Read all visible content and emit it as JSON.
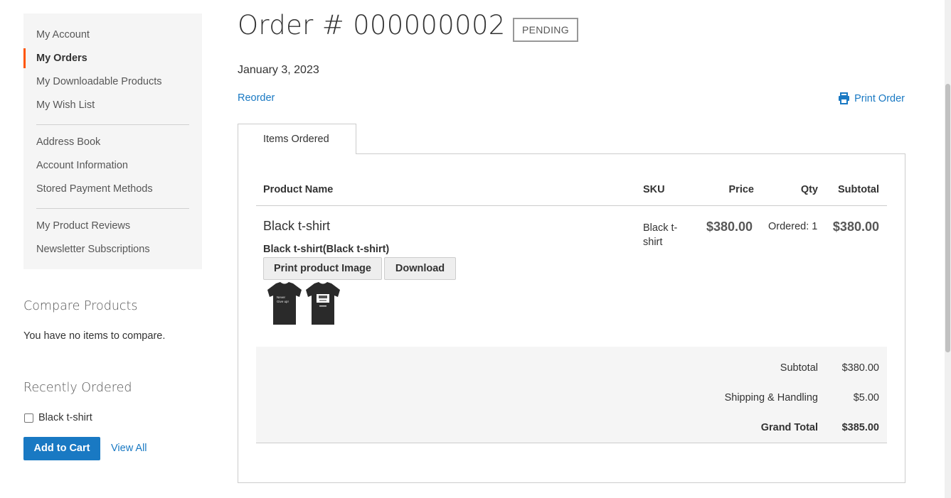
{
  "sidebar": {
    "nav": [
      {
        "label": "My Account"
      },
      {
        "label": "My Orders"
      },
      {
        "label": "My Downloadable Products"
      },
      {
        "label": "My Wish List"
      },
      {
        "label": "Address Book"
      },
      {
        "label": "Account Information"
      },
      {
        "label": "Stored Payment Methods"
      },
      {
        "label": "My Product Reviews"
      },
      {
        "label": "Newsletter Subscriptions"
      }
    ],
    "active_item": "My Orders",
    "compare": {
      "title": "Compare Products",
      "empty_text": "You have no items to compare."
    },
    "recent": {
      "title": "Recently Ordered",
      "item": "Black t-shirt",
      "add_to_cart": "Add to Cart",
      "view_all": "View All"
    }
  },
  "order": {
    "title": "Order # 000000002",
    "status": "PENDING",
    "date": "January 3, 2023",
    "reorder": "Reorder",
    "print": "Print Order"
  },
  "tab": {
    "label": "Items Ordered"
  },
  "table": {
    "headers": {
      "name": "Product Name",
      "sku": "SKU",
      "price": "Price",
      "qty": "Qty",
      "subtotal": "Subtotal"
    },
    "rows": [
      {
        "name": "Black t-shirt",
        "option": "Black t-shirt(Black t-shirt)",
        "print_image_btn": "Print product Image",
        "download_btn": "Download",
        "sku_line1": "Black t-",
        "sku_line2": "shirt",
        "price": "$380.00",
        "qty": "Ordered: 1",
        "subtotal": "$380.00"
      }
    ]
  },
  "totals": {
    "subtotal_label": "Subtotal",
    "subtotal": "$380.00",
    "shipping_label": "Shipping & Handling",
    "shipping": "$5.00",
    "grand_label": "Grand Total",
    "grand": "$385.00"
  },
  "colors": {
    "accent": "#1979c3",
    "active_marker": "#ff5501",
    "panel_bg": "#f5f5f5"
  }
}
